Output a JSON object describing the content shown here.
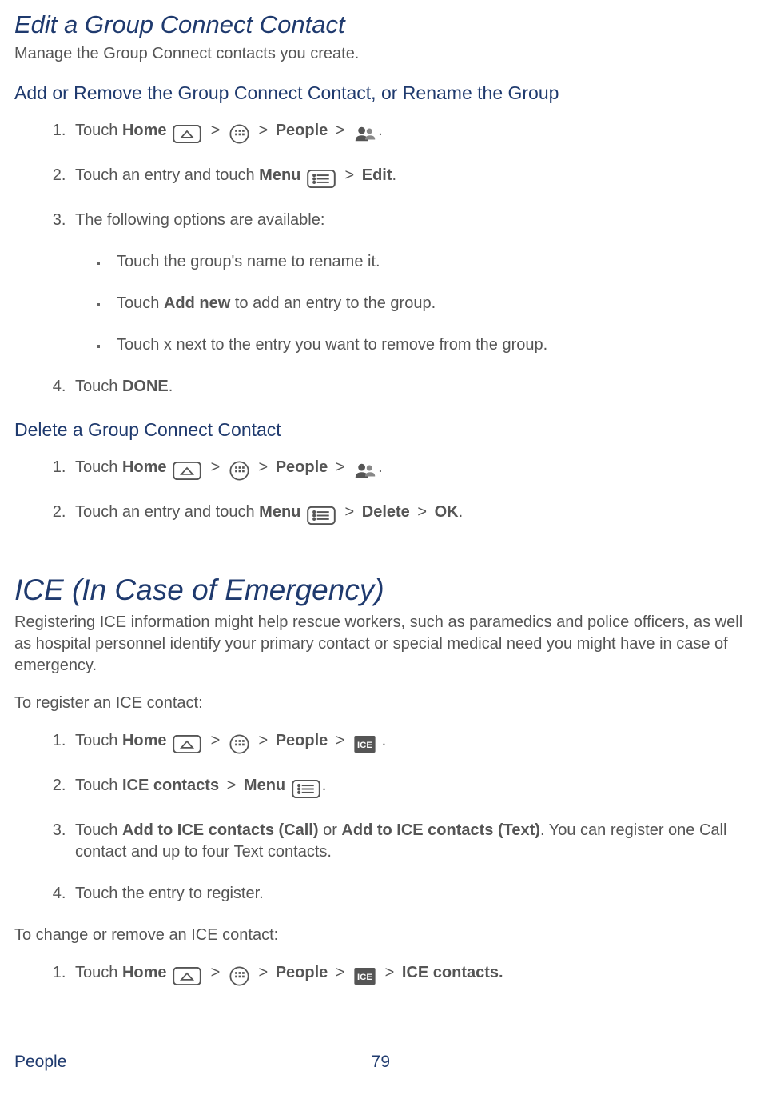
{
  "section1": {
    "title": "Edit a Group Connect Contact",
    "desc": "Manage the Group Connect contacts you create.",
    "sub1": "Add or Remove the Group Connect Contact, or Rename the Group",
    "steps1": {
      "s1a": "Touch ",
      "s1_home": "Home",
      "s1_people": "People",
      "s2a": "Touch an entry and touch ",
      "s2_menu": "Menu",
      "s2_edit": "Edit",
      "s2_period": ".",
      "s3": "The following options are available:",
      "b1": "Touch the group's name to rename it.",
      "b2a": "Touch ",
      "b2_addnew": "Add new",
      "b2b": " to add an entry to the group.",
      "b3": "Touch x next to the entry you want to remove from the group.",
      "s4a": "Touch ",
      "s4_done": "DONE",
      "s4_period": "."
    },
    "sub2": "Delete a Group Connect Contact",
    "steps2": {
      "s1a": "Touch ",
      "s1_home": "Home",
      "s1_people": "People",
      "s2a": "Touch an entry and touch ",
      "s2_menu": "Menu",
      "s2_delete": "Delete",
      "s2_ok": "OK",
      "s2_period": "."
    }
  },
  "section2": {
    "title": "ICE (In Case of Emergency)",
    "desc": "Registering ICE information might help rescue workers, such as paramedics and police officers, as well as hospital personnel identify your primary contact or special medical need you might have in case of emergency.",
    "para1": "To register an ICE contact:",
    "stepsA": {
      "s1a": "Touch ",
      "s1_home": "Home",
      "s1_people": "People",
      "s2a": "Touch ",
      "s2_ice": "ICE contacts",
      "s2_menu": "Menu",
      "s3a": "Touch ",
      "s3_call": "Add to ICE contacts (Call)",
      "s3_or": " or ",
      "s3_text": "Add to ICE contacts (Text)",
      "s3b": ". You can register one Call contact and up to four Text contacts.",
      "s4": "Touch the entry to register."
    },
    "para2": "To change or remove an ICE contact:",
    "stepsB": {
      "s1a": "Touch ",
      "s1_home": "Home",
      "s1_people": "People",
      "s1_ice": "ICE contacts."
    }
  },
  "footer": {
    "left": "People",
    "right": "79"
  },
  "glyphs": {
    "gt": ">"
  }
}
